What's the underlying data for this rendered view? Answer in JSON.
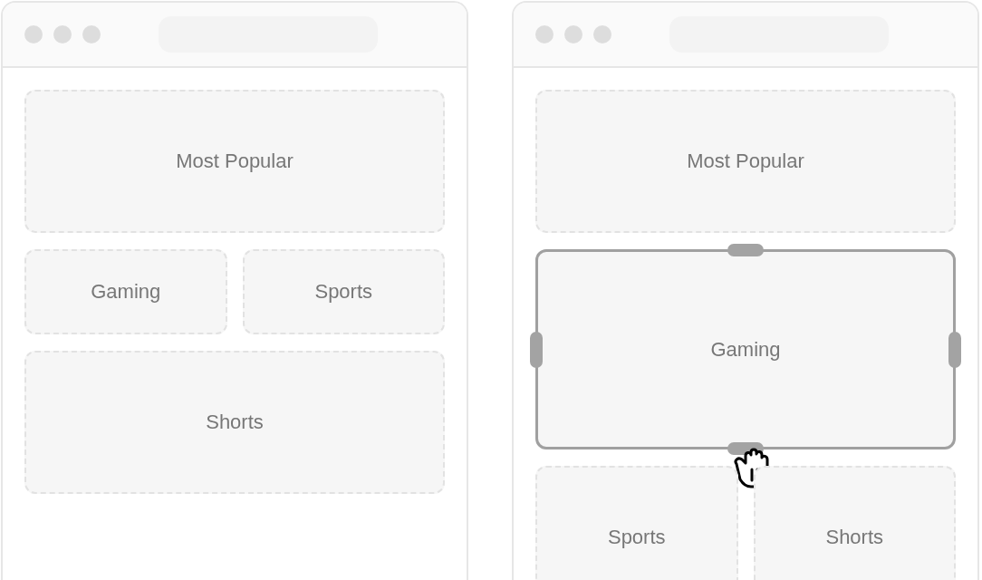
{
  "windows": [
    {
      "tiles": [
        {
          "label": "Most Popular",
          "kind": "banner",
          "selected": false
        },
        {
          "label": "Gaming",
          "kind": "half",
          "selected": false
        },
        {
          "label": "Sports",
          "kind": "half",
          "selected": false
        },
        {
          "label": "Shorts",
          "kind": "banner",
          "selected": false
        }
      ]
    },
    {
      "tiles": [
        {
          "label": "Most Popular",
          "kind": "banner",
          "selected": false
        },
        {
          "label": "Gaming",
          "kind": "feature",
          "selected": true
        },
        {
          "label": "Sports",
          "kind": "block",
          "selected": false
        },
        {
          "label": "Shorts",
          "kind": "block",
          "selected": false
        }
      ]
    }
  ]
}
